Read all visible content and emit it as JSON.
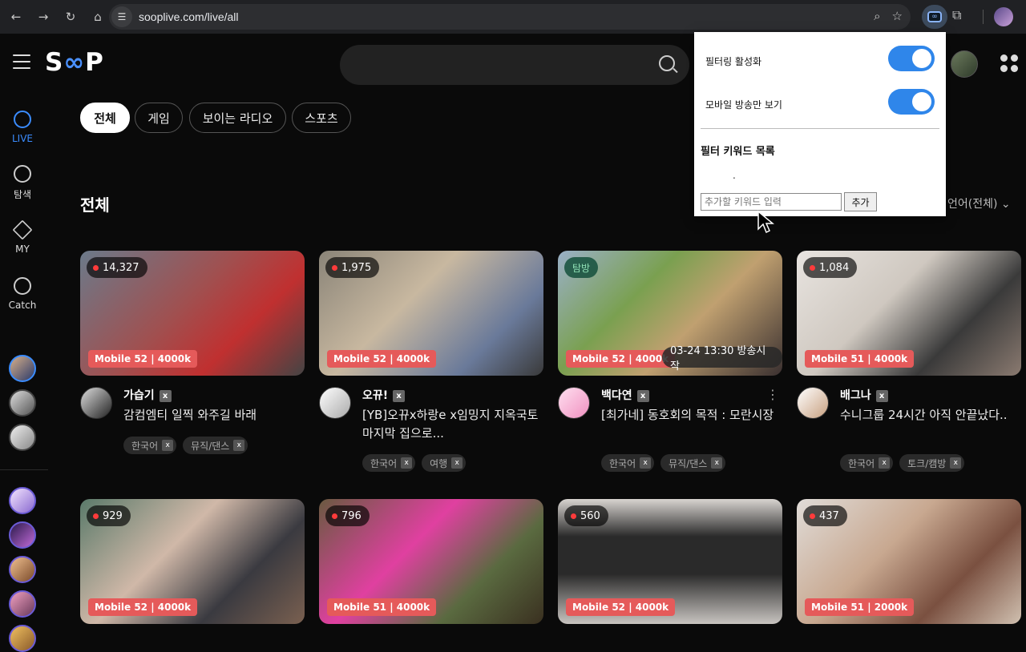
{
  "browser": {
    "url": "sooplive.com/live/all"
  },
  "header": {
    "logo_text": "SOOP"
  },
  "sidebar": {
    "items": [
      {
        "label": "LIVE"
      },
      {
        "label": "탐색"
      },
      {
        "label": "MY"
      },
      {
        "label": "Catch"
      }
    ]
  },
  "categories": [
    "전체",
    "게임",
    "보이는 라디오",
    "스포츠"
  ],
  "section": {
    "title": "전체",
    "sort_label": "언어(전체)"
  },
  "popup": {
    "filter_enable_label": "필터링 활성화",
    "mobile_only_label": "모바일 방송만 보기",
    "keyword_list_title": "필터 키워드 목록",
    "keyword_list_placeholder_dot": ".",
    "keyword_input_placeholder": "추가할 키워드 입력",
    "add_button_label": "추가"
  },
  "streams": [
    {
      "viewers": "14,327",
      "quality": "Mobile 52 | 4000k",
      "name": "가습기",
      "title": "감컴엠티 일찍 와주길 바래",
      "tags": [
        "한국어",
        "뮤직/댄스"
      ]
    },
    {
      "viewers": "1,975",
      "quality": "Mobile 52 | 4000k",
      "name": "오뀨!",
      "title": "[YB]오뀨x하랑e x임밍지 지옥국토 마지막 집으로...",
      "tags": [
        "한국어",
        "여행"
      ]
    },
    {
      "badge": "탐방",
      "quality": "Mobile 52 | 4000k",
      "schedule": "03-24 13:30 방송시작",
      "name": "백다연",
      "title": "[최가네] 동호회의 목적 : 모란시장",
      "tags": [
        "한국어",
        "뮤직/댄스"
      ]
    },
    {
      "viewers": "1,084",
      "quality": "Mobile 51 | 4000k",
      "name": "배그나",
      "title": "수니그룹 24시간 아직 안끝났다..",
      "tags": [
        "한국어",
        "토크/캠방"
      ]
    },
    {
      "viewers": "929",
      "quality": "Mobile 52 | 4000k"
    },
    {
      "viewers": "796",
      "quality": "Mobile 51 | 4000k"
    },
    {
      "viewers": "560",
      "quality": "Mobile 52 | 4000k"
    },
    {
      "viewers": "437",
      "quality": "Mobile 51 | 2000k"
    }
  ],
  "colors": {
    "accent": "#3b8cff",
    "toggle_on": "#2f86ea",
    "quality_badge": "#e55a5a",
    "live_dot": "#ff3b3b"
  }
}
